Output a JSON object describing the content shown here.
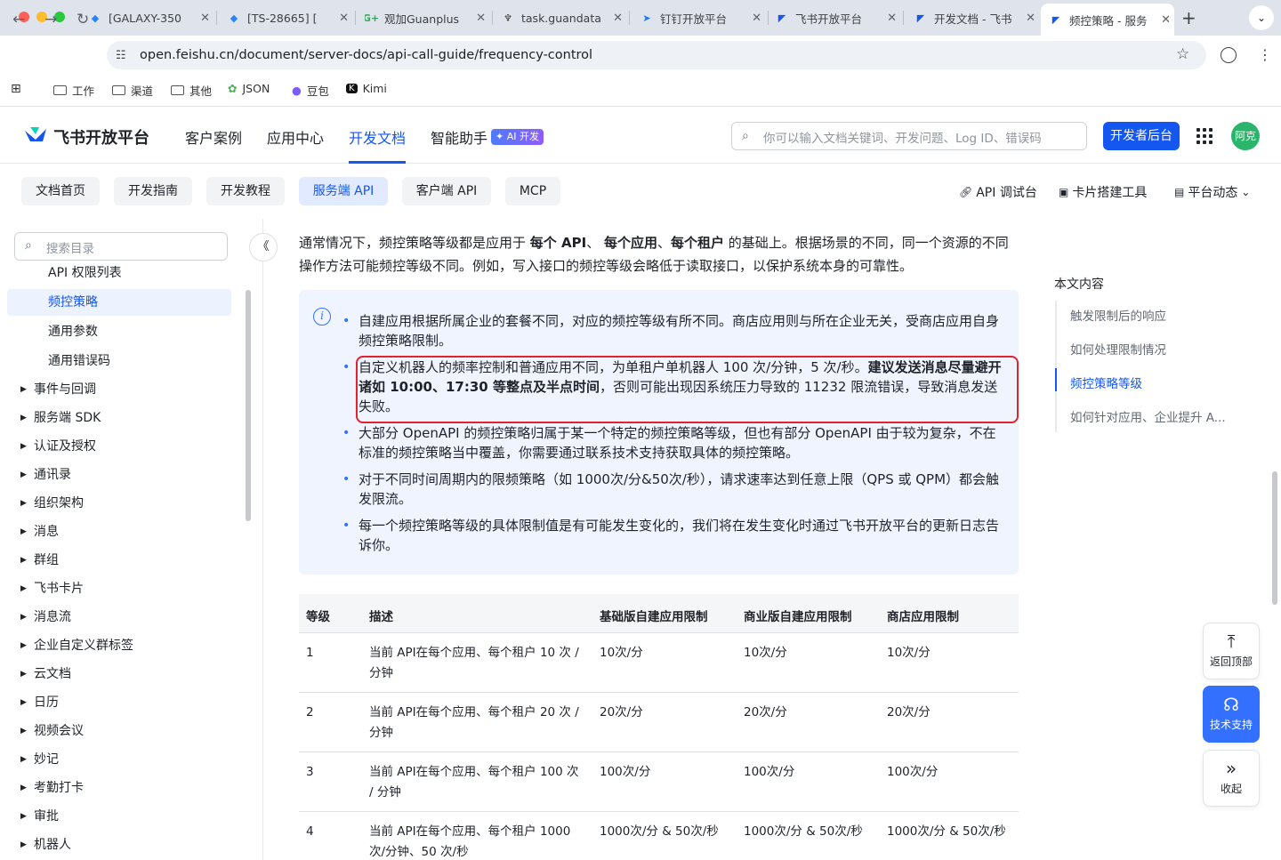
{
  "browser": {
    "tabs": [
      {
        "label": "[GALAXY-350",
        "icon": "jira-icon",
        "color": "#2684ff"
      },
      {
        "label": "[TS-28665] [",
        "icon": "jira-icon",
        "color": "#2684ff"
      },
      {
        "label": "观加Guanplus",
        "icon": "g-plus-icon",
        "color": "#34a853"
      },
      {
        "label": "task.guandata",
        "icon": "task-icon",
        "color": "#333333"
      },
      {
        "label": "钉钉开放平台",
        "icon": "dingtalk-icon",
        "color": "#1677ff"
      },
      {
        "label": "飞书开放平台",
        "icon": "feishu-icon",
        "color": "#1456f0"
      },
      {
        "label": "开发文档 - 飞书",
        "icon": "feishu-icon",
        "color": "#1456f0"
      },
      {
        "label": "频控策略 - 服务",
        "icon": "feishu-icon",
        "color": "#1456f0"
      }
    ],
    "url": "open.feishu.cn/document/server-docs/api-call-guide/frequency-control",
    "bookmarks": [
      {
        "label": "工作",
        "icon": "folder-icon"
      },
      {
        "label": "渠道",
        "icon": "folder-icon"
      },
      {
        "label": "其他",
        "icon": "folder-icon"
      },
      {
        "label": "JSON",
        "icon": "json-icon"
      },
      {
        "label": "豆包",
        "icon": "doubao-icon"
      },
      {
        "label": "Kimi",
        "icon": "kimi-icon"
      }
    ]
  },
  "header": {
    "logo": "飞书开放平台",
    "nav": [
      "客户案例",
      "应用中心",
      "开发文档",
      "智能助手"
    ],
    "ai_badge": "✦ AI 开发",
    "search_placeholder": "你可以输入文档关键词、开发问题、Log ID、错误码",
    "dev_button": "开发者后台",
    "avatar": "阿克",
    "accent": "#1456f0"
  },
  "subnav": {
    "tabs": [
      "文档首页",
      "开发指南",
      "开发教程",
      "服务端 API",
      "客户端 API",
      "MCP"
    ],
    "tools": [
      "API 调试台",
      "卡片搭建工具",
      "平台动态"
    ]
  },
  "sidebar": {
    "search_placeholder": "搜索目录",
    "sub_items": [
      "API 权限列表",
      "频控策略",
      "通用参数",
      "通用错误码"
    ],
    "items": [
      "事件与回调",
      "服务端 SDK",
      "认证及授权",
      "通讯录",
      "组织架构",
      "消息",
      "群组",
      "飞书卡片",
      "消息流",
      "企业自定义群标签",
      "云文档",
      "日历",
      "视频会议",
      "妙记",
      "考勤打卡",
      "审批",
      "机器人"
    ]
  },
  "content": {
    "intro_parts": [
      "通常情况下，频控策略等级都是应用于 ",
      "每个 API",
      "、 ",
      "每个应用",
      "、",
      "每个租户",
      " 的基础上。根据场景的不同，同一个资源的不同操作方法可能频控等级不同。例如，写入接口的频控等级会略低于读取接口，以保护系统本身的可靠性。"
    ],
    "bullets": {
      "b1": "自建应用根据所属企业的套餐不同，对应的频控等级有所不同。商店应用则与所在企业无关，受商店应用自身频控策略限制。",
      "b2_a": "自定义机器人的频率控制和普通应用不同，为单租户单机器人 100 次/分钟，5 次/秒。",
      "b2_bold": "建议发送消息尽量避开诸如 10:00、17:30 等整点及半点时间",
      "b2_c": "，否则可能出现因系统压力导致的 11232 限流错误，导致消息发送失败。",
      "b3": "大部分 OpenAPI 的频控策略归属于某一个特定的频控策略等级，但也有部分 OpenAPI 由于较为复杂，不在标准的频控策略当中覆盖，你需要通过联系技术支持获取具体的频控策略。",
      "b4": "对于不同时间周期内的限频策略（如 1000次/分&50次/秒），请求速率达到任意上限（QPS 或 QPM）都会触发限流。",
      "b5": "每一个频控策略等级的具体限制值是有可能发生变化的，我们将在发生变化时通过飞书开放平台的更新日志告诉你。"
    },
    "table": {
      "headers": [
        "等级",
        "描述",
        "基础版自建应用限制",
        "商业版自建应用限制",
        "商店应用限制"
      ],
      "rows": [
        [
          "1",
          "当前 API在每个应用、每个租户 10 次 / 分钟",
          "10次/分",
          "10次/分",
          "10次/分"
        ],
        [
          "2",
          "当前 API在每个应用、每个租户 20 次 / 分钟",
          "20次/分",
          "20次/分",
          "20次/分"
        ],
        [
          "3",
          "当前 API在每个应用、每个租户 100 次 / 分钟",
          "100次/分",
          "100次/分",
          "100次/分"
        ],
        [
          "4",
          "当前 API在每个应用、每个租户 1000 次/分钟、50 次/秒",
          "1000次/分 & 50次/秒",
          "1000次/分 & 50次/秒",
          "1000次/分 & 50次/秒"
        ]
      ]
    }
  },
  "toc": {
    "title": "本文内容",
    "items": [
      "触发限制后的响应",
      "如何处理限制情况",
      "频控策略等级",
      "如何针对应用、企业提升 A..."
    ]
  },
  "float": {
    "top": "返回顶部",
    "support": "技术支持",
    "collapse": "收起"
  }
}
